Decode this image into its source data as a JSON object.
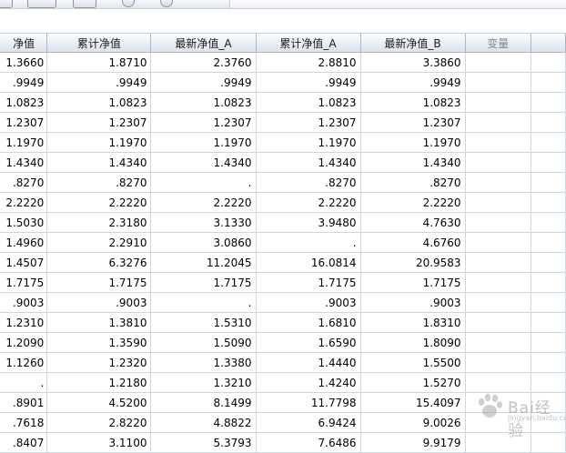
{
  "headers": [
    "净值",
    "累计净值",
    "最新净值_A",
    "累计净值_A",
    "最新净值_B",
    "变量",
    ""
  ],
  "rows": [
    [
      "1.3660",
      "1.8710",
      "2.3760",
      "2.8810",
      "3.3860",
      "",
      ""
    ],
    [
      ".9949",
      ".9949",
      ".9949",
      ".9949",
      ".9949",
      "",
      ""
    ],
    [
      "1.0823",
      "1.0823",
      "1.0823",
      "1.0823",
      "1.0823",
      "",
      ""
    ],
    [
      "1.2307",
      "1.2307",
      "1.2307",
      "1.2307",
      "1.2307",
      "",
      ""
    ],
    [
      "1.1970",
      "1.1970",
      "1.1970",
      "1.1970",
      "1.1970",
      "",
      ""
    ],
    [
      "1.4340",
      "1.4340",
      "1.4340",
      "1.4340",
      "1.4340",
      "",
      ""
    ],
    [
      ".8270",
      ".8270",
      ".",
      ".8270",
      ".8270",
      "",
      ""
    ],
    [
      "2.2220",
      "2.2220",
      "2.2220",
      "2.2220",
      "2.2220",
      "",
      ""
    ],
    [
      "1.5030",
      "2.3180",
      "3.1330",
      "3.9480",
      "4.7630",
      "",
      ""
    ],
    [
      "1.4960",
      "2.2910",
      "3.0860",
      ".",
      "4.6760",
      "",
      ""
    ],
    [
      "1.4507",
      "6.3276",
      "11.2045",
      "16.0814",
      "20.9583",
      "",
      ""
    ],
    [
      "1.7175",
      "1.7175",
      "1.7175",
      "1.7175",
      "1.7175",
      "",
      ""
    ],
    [
      ".9003",
      ".9003",
      ".",
      ".9003",
      ".9003",
      "",
      ""
    ],
    [
      "1.2310",
      "1.3810",
      "1.5310",
      "1.6810",
      "1.8310",
      "",
      ""
    ],
    [
      "1.2090",
      "1.3590",
      "1.5090",
      "1.6590",
      "1.8090",
      "",
      ""
    ],
    [
      "1.1260",
      "1.2320",
      "1.3380",
      "1.4440",
      "1.5500",
      "",
      ""
    ],
    [
      ".",
      "1.2180",
      "1.3210",
      "1.4240",
      "1.5270",
      "",
      ""
    ],
    [
      ".8901",
      "4.5200",
      "8.1499",
      "11.7798",
      "15.4097",
      "",
      ""
    ],
    [
      ".7618",
      "2.8220",
      "4.8822",
      "6.9424",
      "9.0026",
      "",
      ""
    ],
    [
      ".8407",
      "3.1100",
      "5.3793",
      "7.6486",
      "9.9179",
      "",
      ""
    ]
  ],
  "watermark": {
    "brand": "Bai经验",
    "url": "jingyan.baidu.com"
  },
  "colors": {
    "header_bg": "#e3e9f0",
    "grid_line": "#c9d6e3",
    "var_header_text": "#7f8894"
  }
}
